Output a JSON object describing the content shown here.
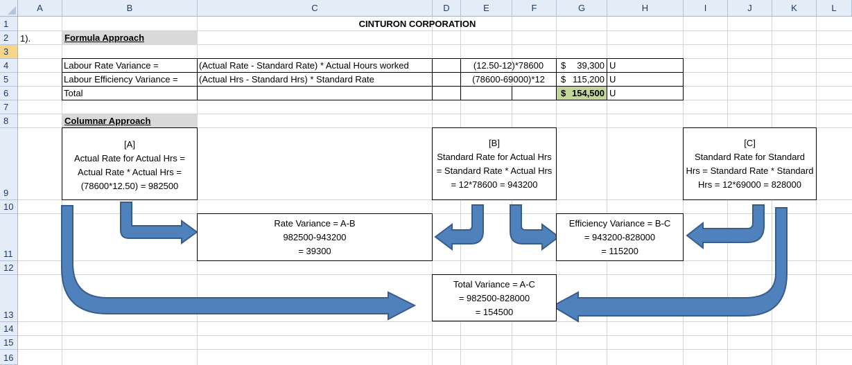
{
  "columns": [
    "A",
    "B",
    "C",
    "D",
    "E",
    "F",
    "G",
    "H",
    "I",
    "J",
    "K",
    "L"
  ],
  "rows": [
    "1",
    "2",
    "3",
    "4",
    "5",
    "6",
    "7",
    "8",
    "9",
    "10",
    "11",
    "12",
    "13",
    "14",
    "15",
    "16"
  ],
  "title": "CINTURON CORPORATION",
  "question_label": "1).",
  "formula_section": {
    "heading": "Formula Approach",
    "rows": [
      {
        "label": "Labour Rate Variance =",
        "formula": "(Actual Rate - Standard Rate) * Actual Hours worked",
        "calc": "(12.50-12)*78600",
        "currency": "$",
        "amount": "39,300",
        "flag": "U"
      },
      {
        "label": "Labour Efficiency Variance =",
        "formula": "(Actual Hrs - Standard Hrs) * Standard Rate",
        "calc": "(78600-69000)*12",
        "currency": "$",
        "amount": "115,200",
        "flag": "U"
      },
      {
        "label": "Total",
        "formula": "",
        "calc": "",
        "currency": "$",
        "amount": "154,500",
        "flag": "U"
      }
    ],
    "total_highlight_color": "#c4d79b"
  },
  "columnar_section": {
    "heading": "Columnar Approach",
    "box_a": {
      "l1": "[A]",
      "l2": "Actual Rate for Actual Hrs =",
      "l3": "Actual Rate * Actual Hrs =",
      "l4": "(78600*12.50) =  982500"
    },
    "box_b": {
      "l1": "[B]",
      "l2": "Standard Rate for Actual Hrs",
      "l3": "= Standard Rate * Actual Hrs",
      "l4": "= 12*78600 = 943200"
    },
    "box_c": {
      "l1": "[C]",
      "l2": "Standard Rate for Standard",
      "l3": "Hrs = Standard Rate * Standard",
      "l4": "Hrs = 12*69000 = 828000"
    },
    "rate_var": {
      "l1": "Rate Variance = A-B",
      "l2": "982500-943200",
      "l3": "= 39300"
    },
    "eff_var": {
      "l1": "Efficiency Variance = B-C",
      "l2": "= 943200-828000",
      "l3": "= 115200"
    },
    "total_var": {
      "l1": "Total Variance = A-C",
      "l2": "= 982500-828000",
      "l3": "= 154500"
    }
  },
  "arrow_color": "#4f81bd",
  "arrow_outline": "#385d8a"
}
